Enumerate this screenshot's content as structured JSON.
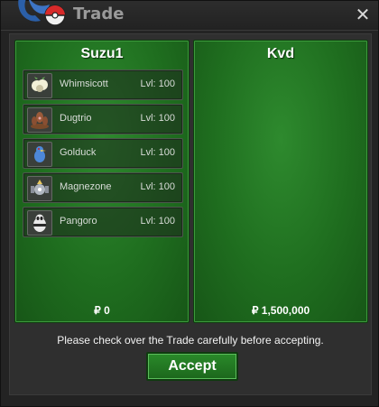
{
  "window": {
    "title": "Trade",
    "close_icon": "close-icon",
    "logo_icon": "game-logo-icon"
  },
  "left_panel": {
    "player_name": "Suzu1",
    "money": "₽ 0",
    "pokemon": [
      {
        "name": "Whimsicott",
        "level": "Lvl: 100",
        "icon": "whimsicott-sprite-icon"
      },
      {
        "name": "Dugtrio",
        "level": "Lvl: 100",
        "icon": "dugtrio-sprite-icon"
      },
      {
        "name": "Golduck",
        "level": "Lvl: 100",
        "icon": "golduck-sprite-icon"
      },
      {
        "name": "Magnezone",
        "level": "Lvl: 100",
        "icon": "magnezone-sprite-icon"
      },
      {
        "name": "Pangoro",
        "level": "Lvl: 100",
        "icon": "pangoro-sprite-icon"
      }
    ]
  },
  "right_panel": {
    "player_name": "Kvd",
    "money": "₽ 1,500,000",
    "pokemon": []
  },
  "footer": {
    "message": "Please check over the Trade carefully before accepting.",
    "accept_label": "Accept"
  },
  "colors": {
    "panel_green": "#1f6e1f",
    "accept_green": "#2a8a2a",
    "background": "#2f2f2f"
  }
}
